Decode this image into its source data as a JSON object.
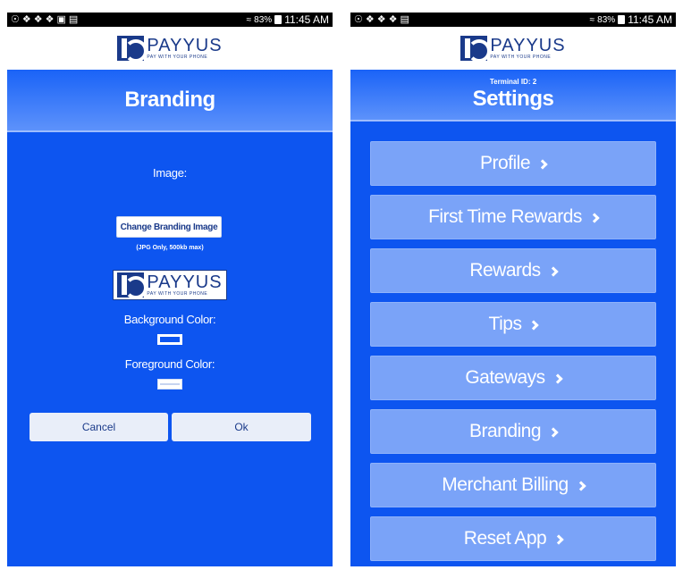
{
  "status_bar": {
    "left_icons": [
      "☉",
      "❖",
      "❖",
      "❖",
      "▣",
      "▤"
    ],
    "battery": "83%",
    "time": "11:45 AM"
  },
  "logo": {
    "name": "PAYYUS",
    "tagline": "PAY WITH YOUR PHONE"
  },
  "branding_screen": {
    "title": "Branding",
    "image_label": "Image:",
    "change_button": "Change Branding Image",
    "hint": "(JPG Only, 500kb max)",
    "background_label": "Background Color:",
    "foreground_label": "Foreground Color:",
    "cancel_button": "Cancel",
    "ok_button": "Ok"
  },
  "settings_screen": {
    "terminal_id": "Terminal ID: 2",
    "title": "Settings",
    "items": [
      {
        "label": "Profile"
      },
      {
        "label": "First Time Rewards"
      },
      {
        "label": "Rewards"
      },
      {
        "label": "Tips"
      },
      {
        "label": "Gateways"
      },
      {
        "label": "Branding"
      },
      {
        "label": "Merchant Billing"
      },
      {
        "label": "Reset App"
      }
    ]
  },
  "colors": {
    "primary_blue": "#0d55f0",
    "menu_button": "#7aa3f8",
    "logo_navy": "#1a3a8a"
  }
}
